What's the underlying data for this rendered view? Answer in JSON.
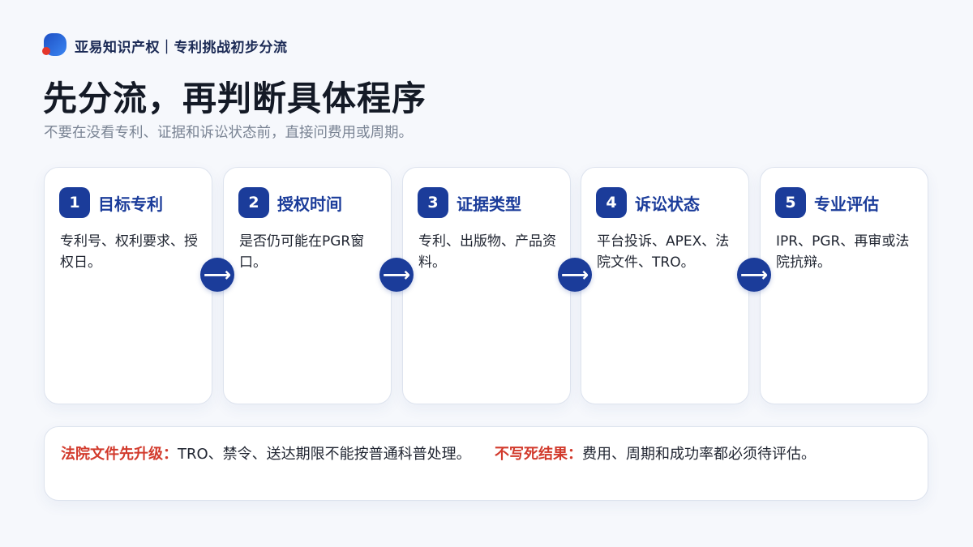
{
  "header": {
    "brand": "亚易知识产权｜专利挑战初步分流",
    "title": "先分流，再判断具体程序",
    "subtitle": "不要在没看专利、证据和诉讼状态前，直接问费用或周期。"
  },
  "steps": [
    {
      "number": "1",
      "title": "目标专利",
      "desc": "专利号、权利要求、授权日。"
    },
    {
      "number": "2",
      "title": "授权时间",
      "desc": "是否仍可能在PGR窗口。"
    },
    {
      "number": "3",
      "title": "证据类型",
      "desc": "专利、出版物、产品资料。"
    },
    {
      "number": "4",
      "title": "诉讼状态",
      "desc": "平台投诉、APEX、法院文件、TRO。"
    },
    {
      "number": "5",
      "title": "专业评估",
      "desc": "IPR、PGR、再审或法院抗辩。"
    }
  ],
  "arrow_glyph": "⟶",
  "notes": {
    "left": {
      "label": "法院文件先升级：",
      "text": "TRO、禁令、送达期限不能按普通科普处理。"
    },
    "right": {
      "label": "不写死结果：",
      "text": "费用、周期和成功率都必须待评估。"
    }
  },
  "colors": {
    "accent": "#1b3c9a",
    "warning": "#d23a2c",
    "logo_dot": "#e5362b"
  },
  "icons": {
    "logo": "brand-logo-icon",
    "arrow": "arrow-right-icon"
  }
}
